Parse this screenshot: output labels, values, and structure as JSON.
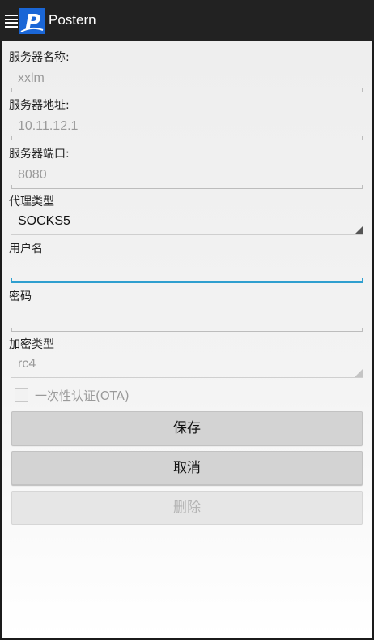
{
  "app": {
    "title": "Postern",
    "logo_letter": "P"
  },
  "form": {
    "server_name": {
      "label": "服务器名称:",
      "value": "xxlm"
    },
    "server_address": {
      "label": "服务器地址:",
      "value": "10.11.12.1"
    },
    "server_port": {
      "label": "服务器端口:",
      "value": "8080"
    },
    "proxy_type": {
      "label": "代理类型",
      "value": "SOCKS5"
    },
    "username": {
      "label": "用户名",
      "value": ""
    },
    "password": {
      "label": "密码",
      "value": ""
    },
    "encryption_type": {
      "label": "加密类型",
      "value": "rc4"
    },
    "ota": {
      "label": "一次性认证(OTA)",
      "checked": false
    }
  },
  "buttons": {
    "save": "保存",
    "cancel": "取消",
    "delete": "删除"
  },
  "colors": {
    "actionbar": "#222222",
    "logo_blue": "#1a66d6",
    "focus_accent": "#2f9fcf"
  }
}
